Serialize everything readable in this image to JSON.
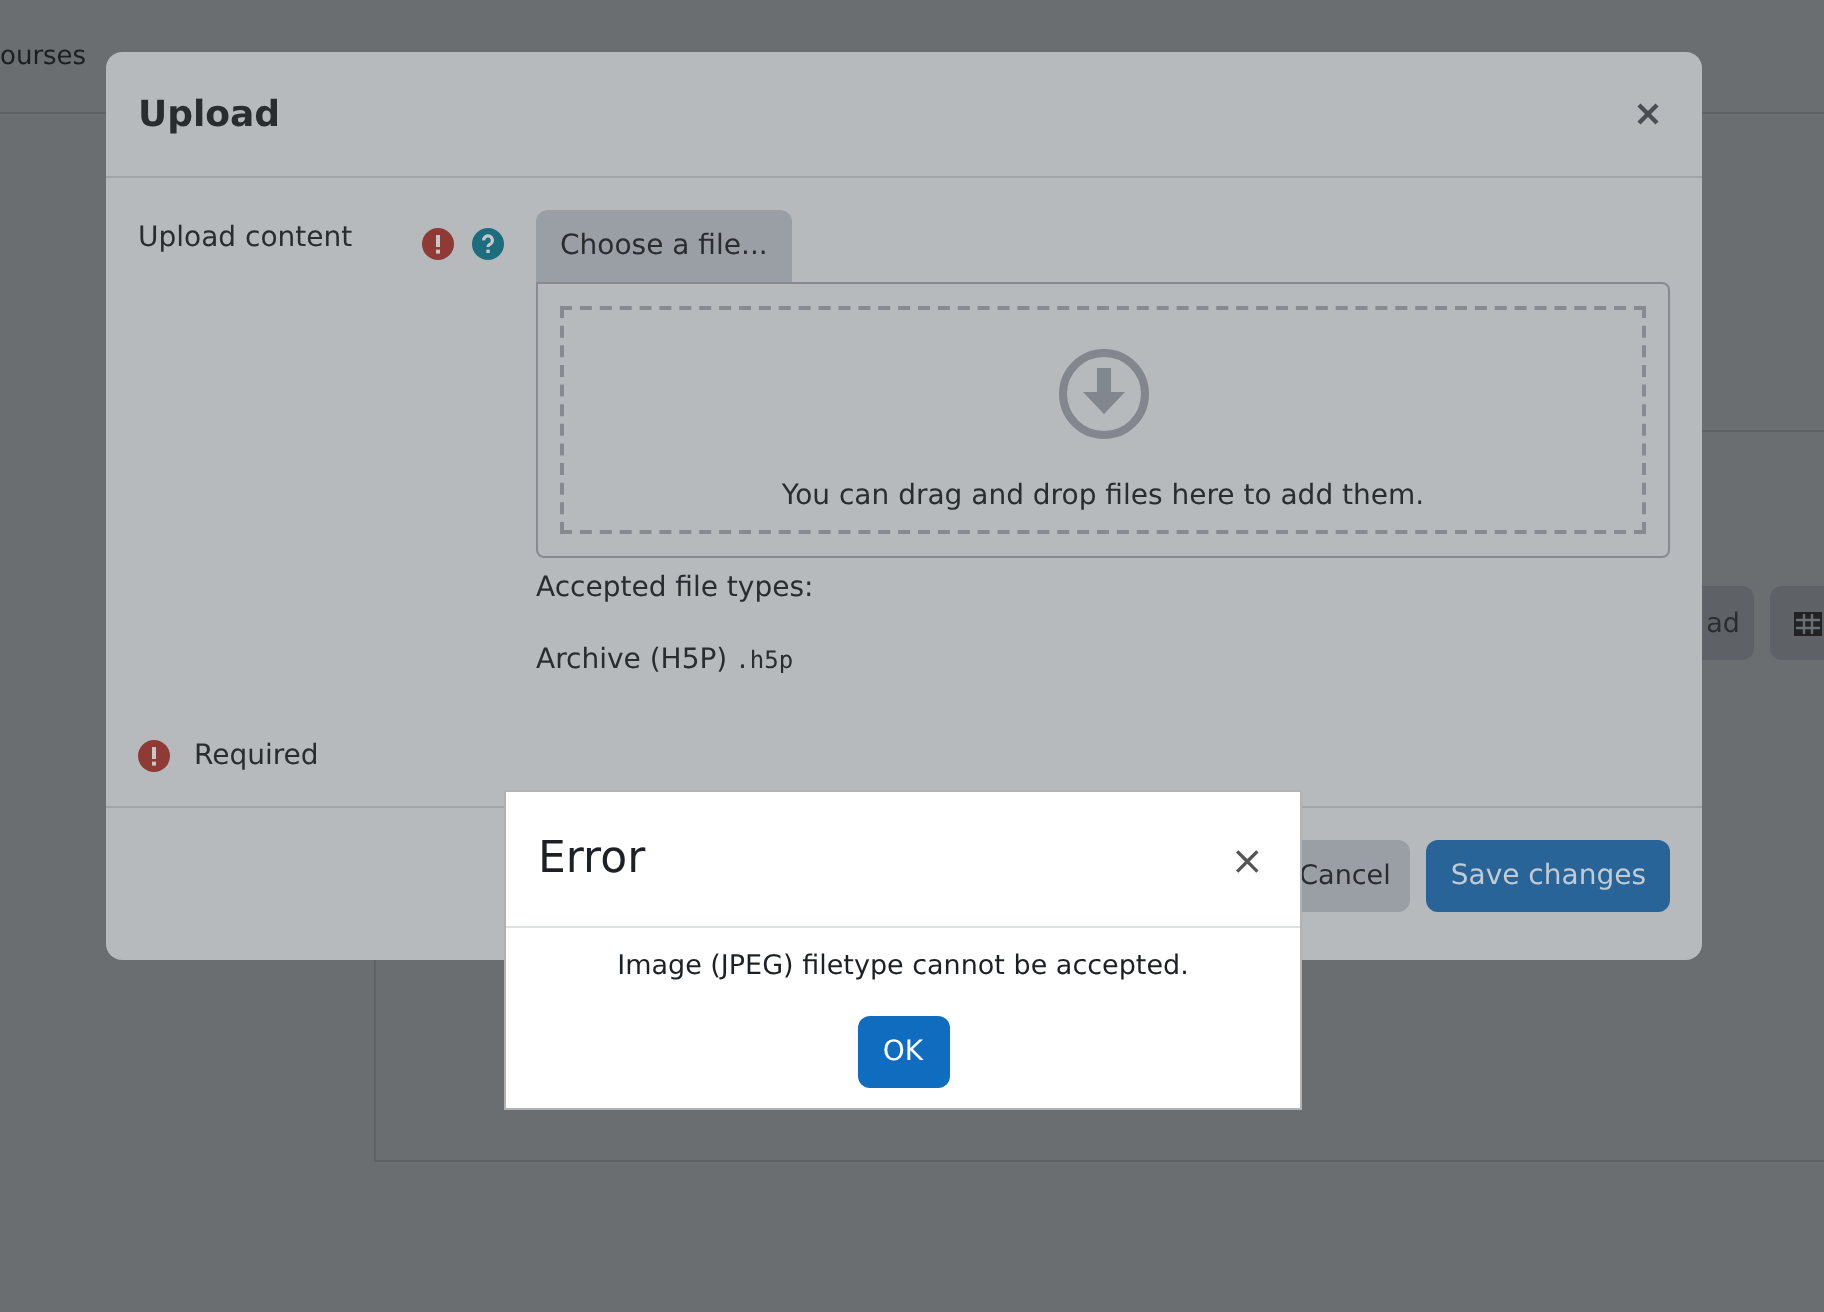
{
  "page_nav": {
    "items": [
      "ourses"
    ]
  },
  "page_toolbar": {
    "button_label": "ad"
  },
  "upload_dialog": {
    "title": "Upload",
    "field_label": "Upload content",
    "choose_button": "Choose a file...",
    "drop_text": "You can drag and drop files here to add them.",
    "accepted_label": "Accepted file types:",
    "file_type": {
      "name": "Archive (H5P)",
      "extension": ".h5p"
    },
    "required_text": "Required",
    "buttons": [
      {
        "label": "Cancel",
        "kind": "secondary"
      },
      {
        "label": "Save changes",
        "kind": "primary"
      }
    ]
  },
  "error_dialog": {
    "title": "Error",
    "close": "×",
    "message": "Image (JPEG) filetype cannot be accepted.",
    "ok_button": "OK"
  }
}
